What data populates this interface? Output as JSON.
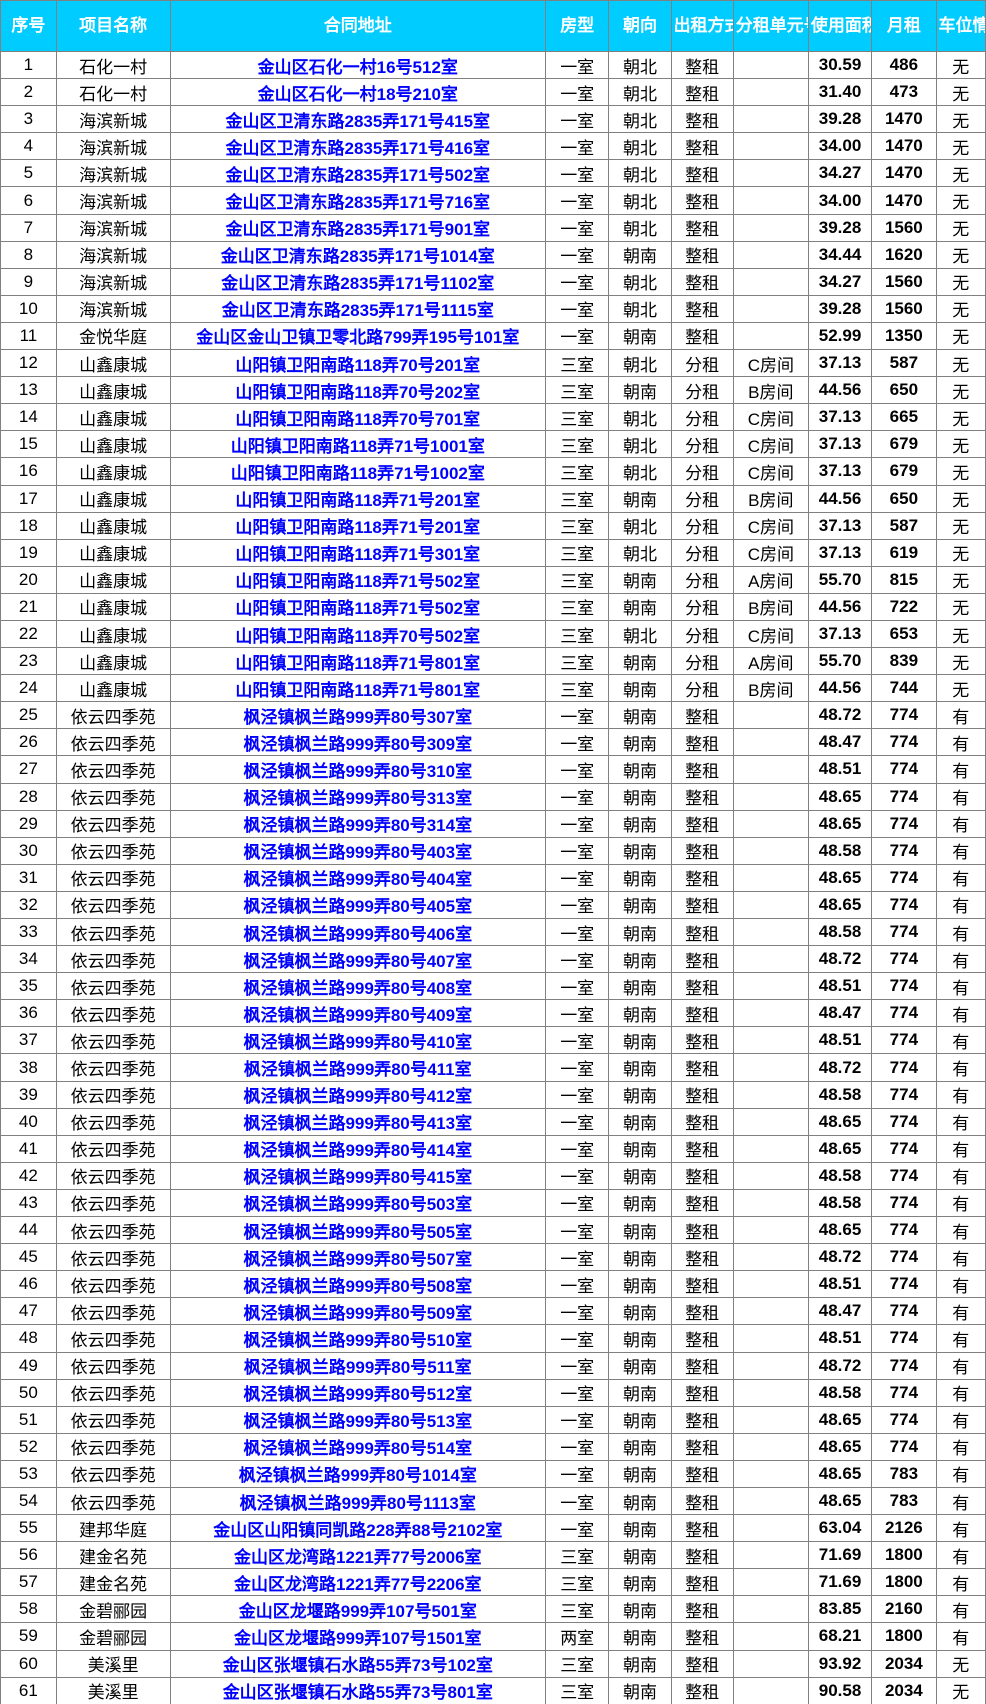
{
  "table": {
    "accent_header_bg": "#00ccff",
    "header_text_color": "#ffffff",
    "address_link_color": "#0000ff",
    "grid_line_color": "#808080",
    "columns": [
      {
        "key": "seq",
        "label": "序号"
      },
      {
        "key": "proj",
        "label": "项目名称"
      },
      {
        "key": "addr",
        "label": "合同地址"
      },
      {
        "key": "type",
        "label": "房型"
      },
      {
        "key": "dir",
        "label": "朝向"
      },
      {
        "key": "mode",
        "label": "出租方式"
      },
      {
        "key": "unit",
        "label": "分租单元号"
      },
      {
        "key": "area",
        "label": "使用面积"
      },
      {
        "key": "rent",
        "label": "月租"
      },
      {
        "key": "park",
        "label": "车位情况"
      }
    ],
    "rows": [
      [
        "1",
        "石化一村",
        "金山区石化一村16号512室",
        "一室",
        "朝北",
        "整租",
        "",
        "30.59",
        "486",
        "无"
      ],
      [
        "2",
        "石化一村",
        "金山区石化一村18号210室",
        "一室",
        "朝北",
        "整租",
        "",
        "31.40",
        "473",
        "无"
      ],
      [
        "3",
        "海滨新城",
        "金山区卫清东路2835弄171号415室",
        "一室",
        "朝北",
        "整租",
        "",
        "39.28",
        "1470",
        "无"
      ],
      [
        "4",
        "海滨新城",
        "金山区卫清东路2835弄171号416室",
        "一室",
        "朝北",
        "整租",
        "",
        "34.00",
        "1470",
        "无"
      ],
      [
        "5",
        "海滨新城",
        "金山区卫清东路2835弄171号502室",
        "一室",
        "朝北",
        "整租",
        "",
        "34.27",
        "1470",
        "无"
      ],
      [
        "6",
        "海滨新城",
        "金山区卫清东路2835弄171号716室",
        "一室",
        "朝北",
        "整租",
        "",
        "34.00",
        "1470",
        "无"
      ],
      [
        "7",
        "海滨新城",
        "金山区卫清东路2835弄171号901室",
        "一室",
        "朝北",
        "整租",
        "",
        "39.28",
        "1560",
        "无"
      ],
      [
        "8",
        "海滨新城",
        "金山区卫清东路2835弄171号1014室",
        "一室",
        "朝南",
        "整租",
        "",
        "34.44",
        "1620",
        "无"
      ],
      [
        "9",
        "海滨新城",
        "金山区卫清东路2835弄171号1102室",
        "一室",
        "朝北",
        "整租",
        "",
        "34.27",
        "1560",
        "无"
      ],
      [
        "10",
        "海滨新城",
        "金山区卫清东路2835弄171号1115室",
        "一室",
        "朝北",
        "整租",
        "",
        "39.28",
        "1560",
        "无"
      ],
      [
        "11",
        "金悦华庭",
        "金山区金山卫镇卫零北路799弄195号101室",
        "一室",
        "朝南",
        "整租",
        "",
        "52.99",
        "1350",
        "无"
      ],
      [
        "12",
        "山鑫康城",
        "山阳镇卫阳南路118弄70号201室",
        "三室",
        "朝北",
        "分租",
        "C房间",
        "37.13",
        "587",
        "无"
      ],
      [
        "13",
        "山鑫康城",
        "山阳镇卫阳南路118弄70号202室",
        "三室",
        "朝南",
        "分租",
        "B房间",
        "44.56",
        "650",
        "无"
      ],
      [
        "14",
        "山鑫康城",
        "山阳镇卫阳南路118弄70号701室",
        "三室",
        "朝北",
        "分租",
        "C房间",
        "37.13",
        "665",
        "无"
      ],
      [
        "15",
        "山鑫康城",
        "山阳镇卫阳南路118弄71号1001室",
        "三室",
        "朝北",
        "分租",
        "C房间",
        "37.13",
        "679",
        "无"
      ],
      [
        "16",
        "山鑫康城",
        "山阳镇卫阳南路118弄71号1002室",
        "三室",
        "朝北",
        "分租",
        "C房间",
        "37.13",
        "679",
        "无"
      ],
      [
        "17",
        "山鑫康城",
        "山阳镇卫阳南路118弄71号201室",
        "三室",
        "朝南",
        "分租",
        "B房间",
        "44.56",
        "650",
        "无"
      ],
      [
        "18",
        "山鑫康城",
        "山阳镇卫阳南路118弄71号201室",
        "三室",
        "朝北",
        "分租",
        "C房间",
        "37.13",
        "587",
        "无"
      ],
      [
        "19",
        "山鑫康城",
        "山阳镇卫阳南路118弄71号301室",
        "三室",
        "朝北",
        "分租",
        "C房间",
        "37.13",
        "619",
        "无"
      ],
      [
        "20",
        "山鑫康城",
        "山阳镇卫阳南路118弄71号502室",
        "三室",
        "朝南",
        "分租",
        "A房间",
        "55.70",
        "815",
        "无"
      ],
      [
        "21",
        "山鑫康城",
        "山阳镇卫阳南路118弄71号502室",
        "三室",
        "朝南",
        "分租",
        "B房间",
        "44.56",
        "722",
        "无"
      ],
      [
        "22",
        "山鑫康城",
        "山阳镇卫阳南路118弄70号502室",
        "三室",
        "朝北",
        "分租",
        "C房间",
        "37.13",
        "653",
        "无"
      ],
      [
        "23",
        "山鑫康城",
        "山阳镇卫阳南路118弄71号801室",
        "三室",
        "朝南",
        "分租",
        "A房间",
        "55.70",
        "839",
        "无"
      ],
      [
        "24",
        "山鑫康城",
        "山阳镇卫阳南路118弄71号801室",
        "三室",
        "朝南",
        "分租",
        "B房间",
        "44.56",
        "744",
        "无"
      ],
      [
        "25",
        "依云四季苑",
        "枫泾镇枫兰路999弄80号307室",
        "一室",
        "朝南",
        "整租",
        "",
        "48.72",
        "774",
        "有"
      ],
      [
        "26",
        "依云四季苑",
        "枫泾镇枫兰路999弄80号309室",
        "一室",
        "朝南",
        "整租",
        "",
        "48.47",
        "774",
        "有"
      ],
      [
        "27",
        "依云四季苑",
        "枫泾镇枫兰路999弄80号310室",
        "一室",
        "朝南",
        "整租",
        "",
        "48.51",
        "774",
        "有"
      ],
      [
        "28",
        "依云四季苑",
        "枫泾镇枫兰路999弄80号313室",
        "一室",
        "朝南",
        "整租",
        "",
        "48.65",
        "774",
        "有"
      ],
      [
        "29",
        "依云四季苑",
        "枫泾镇枫兰路999弄80号314室",
        "一室",
        "朝南",
        "整租",
        "",
        "48.65",
        "774",
        "有"
      ],
      [
        "30",
        "依云四季苑",
        "枫泾镇枫兰路999弄80号403室",
        "一室",
        "朝南",
        "整租",
        "",
        "48.58",
        "774",
        "有"
      ],
      [
        "31",
        "依云四季苑",
        "枫泾镇枫兰路999弄80号404室",
        "一室",
        "朝南",
        "整租",
        "",
        "48.65",
        "774",
        "有"
      ],
      [
        "32",
        "依云四季苑",
        "枫泾镇枫兰路999弄80号405室",
        "一室",
        "朝南",
        "整租",
        "",
        "48.65",
        "774",
        "有"
      ],
      [
        "33",
        "依云四季苑",
        "枫泾镇枫兰路999弄80号406室",
        "一室",
        "朝南",
        "整租",
        "",
        "48.58",
        "774",
        "有"
      ],
      [
        "34",
        "依云四季苑",
        "枫泾镇枫兰路999弄80号407室",
        "一室",
        "朝南",
        "整租",
        "",
        "48.72",
        "774",
        "有"
      ],
      [
        "35",
        "依云四季苑",
        "枫泾镇枫兰路999弄80号408室",
        "一室",
        "朝南",
        "整租",
        "",
        "48.51",
        "774",
        "有"
      ],
      [
        "36",
        "依云四季苑",
        "枫泾镇枫兰路999弄80号409室",
        "一室",
        "朝南",
        "整租",
        "",
        "48.47",
        "774",
        "有"
      ],
      [
        "37",
        "依云四季苑",
        "枫泾镇枫兰路999弄80号410室",
        "一室",
        "朝南",
        "整租",
        "",
        "48.51",
        "774",
        "有"
      ],
      [
        "38",
        "依云四季苑",
        "枫泾镇枫兰路999弄80号411室",
        "一室",
        "朝南",
        "整租",
        "",
        "48.72",
        "774",
        "有"
      ],
      [
        "39",
        "依云四季苑",
        "枫泾镇枫兰路999弄80号412室",
        "一室",
        "朝南",
        "整租",
        "",
        "48.58",
        "774",
        "有"
      ],
      [
        "40",
        "依云四季苑",
        "枫泾镇枫兰路999弄80号413室",
        "一室",
        "朝南",
        "整租",
        "",
        "48.65",
        "774",
        "有"
      ],
      [
        "41",
        "依云四季苑",
        "枫泾镇枫兰路999弄80号414室",
        "一室",
        "朝南",
        "整租",
        "",
        "48.65",
        "774",
        "有"
      ],
      [
        "42",
        "依云四季苑",
        "枫泾镇枫兰路999弄80号415室",
        "一室",
        "朝南",
        "整租",
        "",
        "48.58",
        "774",
        "有"
      ],
      [
        "43",
        "依云四季苑",
        "枫泾镇枫兰路999弄80号503室",
        "一室",
        "朝南",
        "整租",
        "",
        "48.58",
        "774",
        "有"
      ],
      [
        "44",
        "依云四季苑",
        "枫泾镇枫兰路999弄80号505室",
        "一室",
        "朝南",
        "整租",
        "",
        "48.65",
        "774",
        "有"
      ],
      [
        "45",
        "依云四季苑",
        "枫泾镇枫兰路999弄80号507室",
        "一室",
        "朝南",
        "整租",
        "",
        "48.72",
        "774",
        "有"
      ],
      [
        "46",
        "依云四季苑",
        "枫泾镇枫兰路999弄80号508室",
        "一室",
        "朝南",
        "整租",
        "",
        "48.51",
        "774",
        "有"
      ],
      [
        "47",
        "依云四季苑",
        "枫泾镇枫兰路999弄80号509室",
        "一室",
        "朝南",
        "整租",
        "",
        "48.47",
        "774",
        "有"
      ],
      [
        "48",
        "依云四季苑",
        "枫泾镇枫兰路999弄80号510室",
        "一室",
        "朝南",
        "整租",
        "",
        "48.51",
        "774",
        "有"
      ],
      [
        "49",
        "依云四季苑",
        "枫泾镇枫兰路999弄80号511室",
        "一室",
        "朝南",
        "整租",
        "",
        "48.72",
        "774",
        "有"
      ],
      [
        "50",
        "依云四季苑",
        "枫泾镇枫兰路999弄80号512室",
        "一室",
        "朝南",
        "整租",
        "",
        "48.58",
        "774",
        "有"
      ],
      [
        "51",
        "依云四季苑",
        "枫泾镇枫兰路999弄80号513室",
        "一室",
        "朝南",
        "整租",
        "",
        "48.65",
        "774",
        "有"
      ],
      [
        "52",
        "依云四季苑",
        "枫泾镇枫兰路999弄80号514室",
        "一室",
        "朝南",
        "整租",
        "",
        "48.65",
        "774",
        "有"
      ],
      [
        "53",
        "依云四季苑",
        "枫泾镇枫兰路999弄80号1014室",
        "一室",
        "朝南",
        "整租",
        "",
        "48.65",
        "783",
        "有"
      ],
      [
        "54",
        "依云四季苑",
        "枫泾镇枫兰路999弄80号1113室",
        "一室",
        "朝南",
        "整租",
        "",
        "48.65",
        "783",
        "有"
      ],
      [
        "55",
        "建邦华庭",
        "金山区山阳镇同凯路228弄88号2102室",
        "一室",
        "朝南",
        "整租",
        "",
        "63.04",
        "2126",
        "有"
      ],
      [
        "56",
        "建金名苑",
        "金山区龙湾路1221弄77号2006室",
        "三室",
        "朝南",
        "整租",
        "",
        "71.69",
        "1800",
        "有"
      ],
      [
        "57",
        "建金名苑",
        "金山区龙湾路1221弄77号2206室",
        "三室",
        "朝南",
        "整租",
        "",
        "71.69",
        "1800",
        "有"
      ],
      [
        "58",
        "金碧郦园",
        "金山区龙堰路999弄107号501室",
        "三室",
        "朝南",
        "整租",
        "",
        "83.85",
        "2160",
        "有"
      ],
      [
        "59",
        "金碧郦园",
        "金山区龙堰路999弄107号1501室",
        "两室",
        "朝南",
        "整租",
        "",
        "68.21",
        "1800",
        "有"
      ],
      [
        "60",
        "美溪里",
        "金山区张堰镇石水路55弄73号102室",
        "三室",
        "朝南",
        "整租",
        "",
        "93.92",
        "2034",
        "无"
      ],
      [
        "61",
        "美溪里",
        "金山区张堰镇石水路55弄73号801室",
        "三室",
        "朝南",
        "整租",
        "",
        "90.58",
        "2034",
        "无"
      ]
    ]
  }
}
